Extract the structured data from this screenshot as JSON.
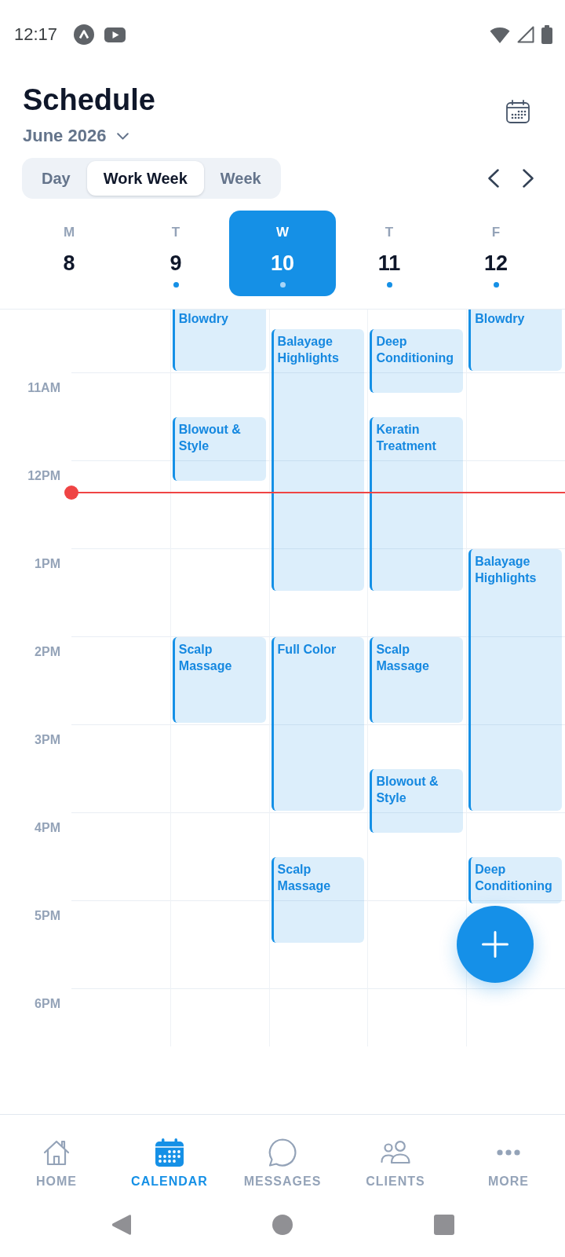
{
  "status_bar": {
    "time": "12:17"
  },
  "header": {
    "title": "Schedule",
    "month": "June 2026"
  },
  "view_tabs": [
    {
      "label": "Day",
      "selected": false
    },
    {
      "label": "Work Week",
      "selected": true
    },
    {
      "label": "Week",
      "selected": false
    }
  ],
  "days": [
    {
      "weekday": "M",
      "date": "8",
      "selected": false,
      "has_events": false
    },
    {
      "weekday": "T",
      "date": "9",
      "selected": false,
      "has_events": true,
      "events": [
        {
          "title": "Blowdry"
        },
        {
          "title": "Blowout & Style"
        },
        {
          "title": "Scalp Massage"
        }
      ]
    },
    {
      "weekday": "W",
      "date": "10",
      "selected": true,
      "has_events": true,
      "events": [
        {
          "title": "Balayage Highlights"
        },
        {
          "title": "Full Color"
        },
        {
          "title": "Scalp Massage"
        }
      ]
    },
    {
      "weekday": "T",
      "date": "11",
      "selected": false,
      "has_events": true,
      "events": [
        {
          "title": "Deep Conditioning"
        },
        {
          "title": "Keratin Treatment"
        },
        {
          "title": "Scalp Massage"
        },
        {
          "title": "Blowout & Style"
        }
      ]
    },
    {
      "weekday": "F",
      "date": "12",
      "selected": false,
      "has_events": true,
      "events": [
        {
          "title": "Blowdry"
        },
        {
          "title": "Balayage Highlights"
        },
        {
          "title": "Deep Conditioning"
        }
      ]
    }
  ],
  "time_labels": [
    "11AM",
    "12PM",
    "1PM",
    "2PM",
    "3PM",
    "4PM",
    "5PM",
    "6PM"
  ],
  "bottom_nav": [
    {
      "label": "HOME",
      "selected": false
    },
    {
      "label": "CALENDAR",
      "selected": true
    },
    {
      "label": "MESSAGES",
      "selected": false
    },
    {
      "label": "CLIENTS",
      "selected": false
    },
    {
      "label": "MORE",
      "selected": false
    }
  ]
}
